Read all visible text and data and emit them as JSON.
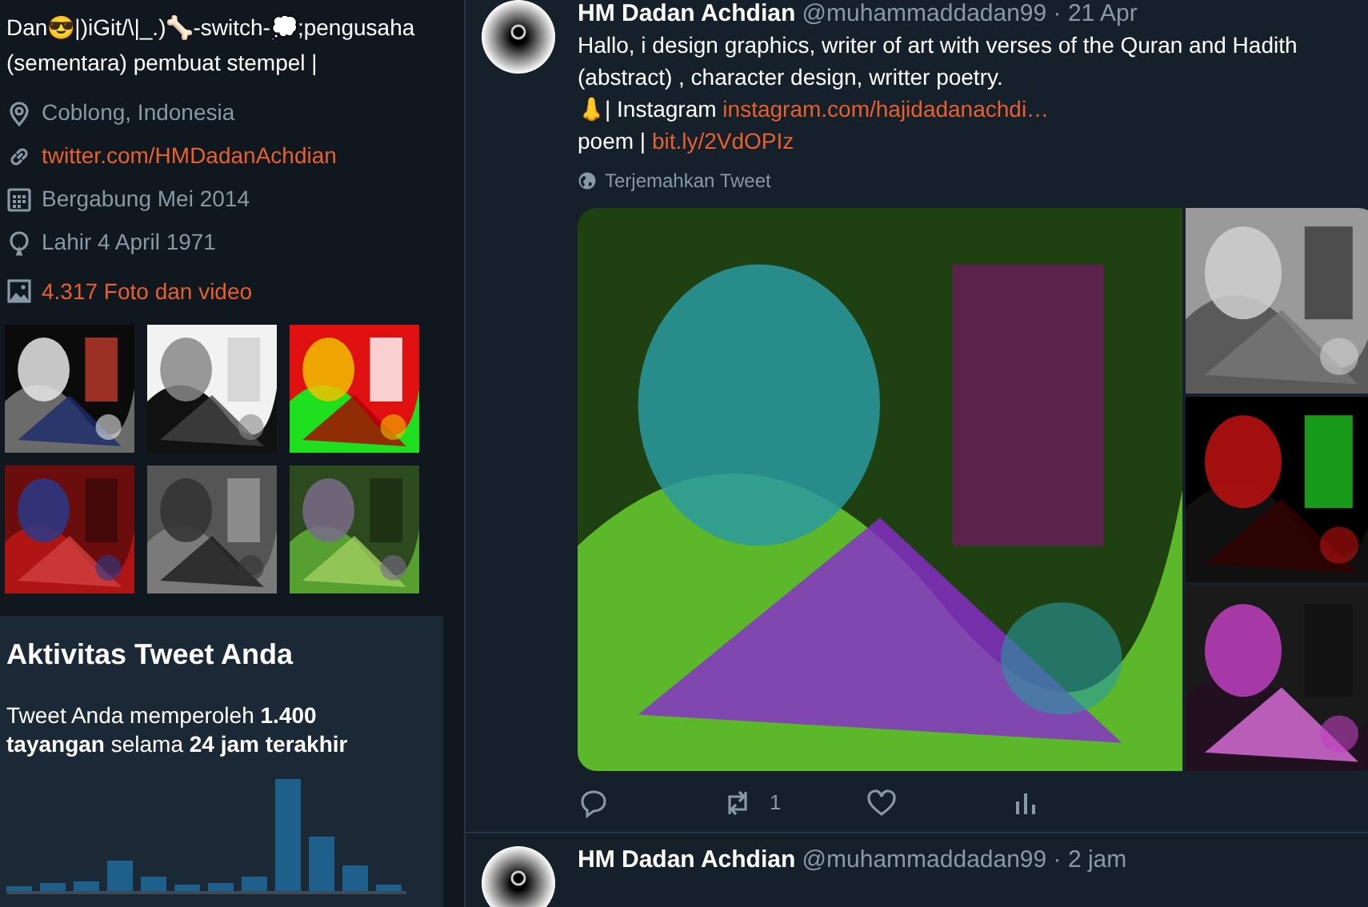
{
  "profile": {
    "bio": "Dan😎|)iGit/\\|_.)🦴-switch-💭;pengusaha (sementara) pembuat stempel |",
    "details": [
      {
        "kind": "location",
        "text": "Coblong, Indonesia",
        "link": false
      },
      {
        "kind": "link",
        "text": "twitter.com/HMDadanAchdian",
        "link": true
      },
      {
        "kind": "joined",
        "text": "Bergabung Mei 2014",
        "link": false
      },
      {
        "kind": "birthday",
        "text": "Lahir 4 April 1971",
        "link": false
      }
    ],
    "media_link": "4.317 Foto dan video",
    "thumbnails": [
      {
        "kind": "picture"
      },
      {
        "kind": "picture"
      },
      {
        "kind": "picture"
      },
      {
        "kind": "picture"
      },
      {
        "kind": "picture"
      },
      {
        "kind": "picture"
      }
    ]
  },
  "activity": {
    "title": "Aktivitas Tweet Anda",
    "summary": "Tweet Anda memperoleh **1.400 tayangan** selama **24 jam terakhir**"
  },
  "tweets": [
    {
      "author": "HM Dadan Achdian",
      "handle": "@muhammaddadan99",
      "time": "· 21 Apr",
      "lines": [
        [
          {
            "text": "Hallo, i design graphics, writer of art with verses of the Quran and Hadith (abstract) , character design, writter poetry.",
            "link": false
          }
        ],
        [
          {
            "text": "👃| Instagram",
            "link": false
          },
          {
            "text": "instagram.com/hajidadanachdi…",
            "link": true
          }
        ],
        [
          {
            "text": "poem |",
            "link": false
          },
          {
            "text": "bit.ly/2VdOPIz",
            "link": true
          }
        ]
      ],
      "translate": "Terjemahkan Tweet",
      "media": [
        {
          "kind": "picture"
        },
        {
          "kind": "picture"
        },
        {
          "kind": "picture"
        },
        {
          "kind": "picture"
        }
      ],
      "actions": [
        {
          "kind": "reply"
        },
        {
          "kind": "retweet",
          "count": "1"
        },
        {
          "kind": "like"
        },
        {
          "kind": "analytics"
        }
      ]
    },
    {
      "author": "HM Dadan Achdian",
      "handle": "@muhammaddadan99",
      "time": "· 2 jam"
    }
  ]
}
